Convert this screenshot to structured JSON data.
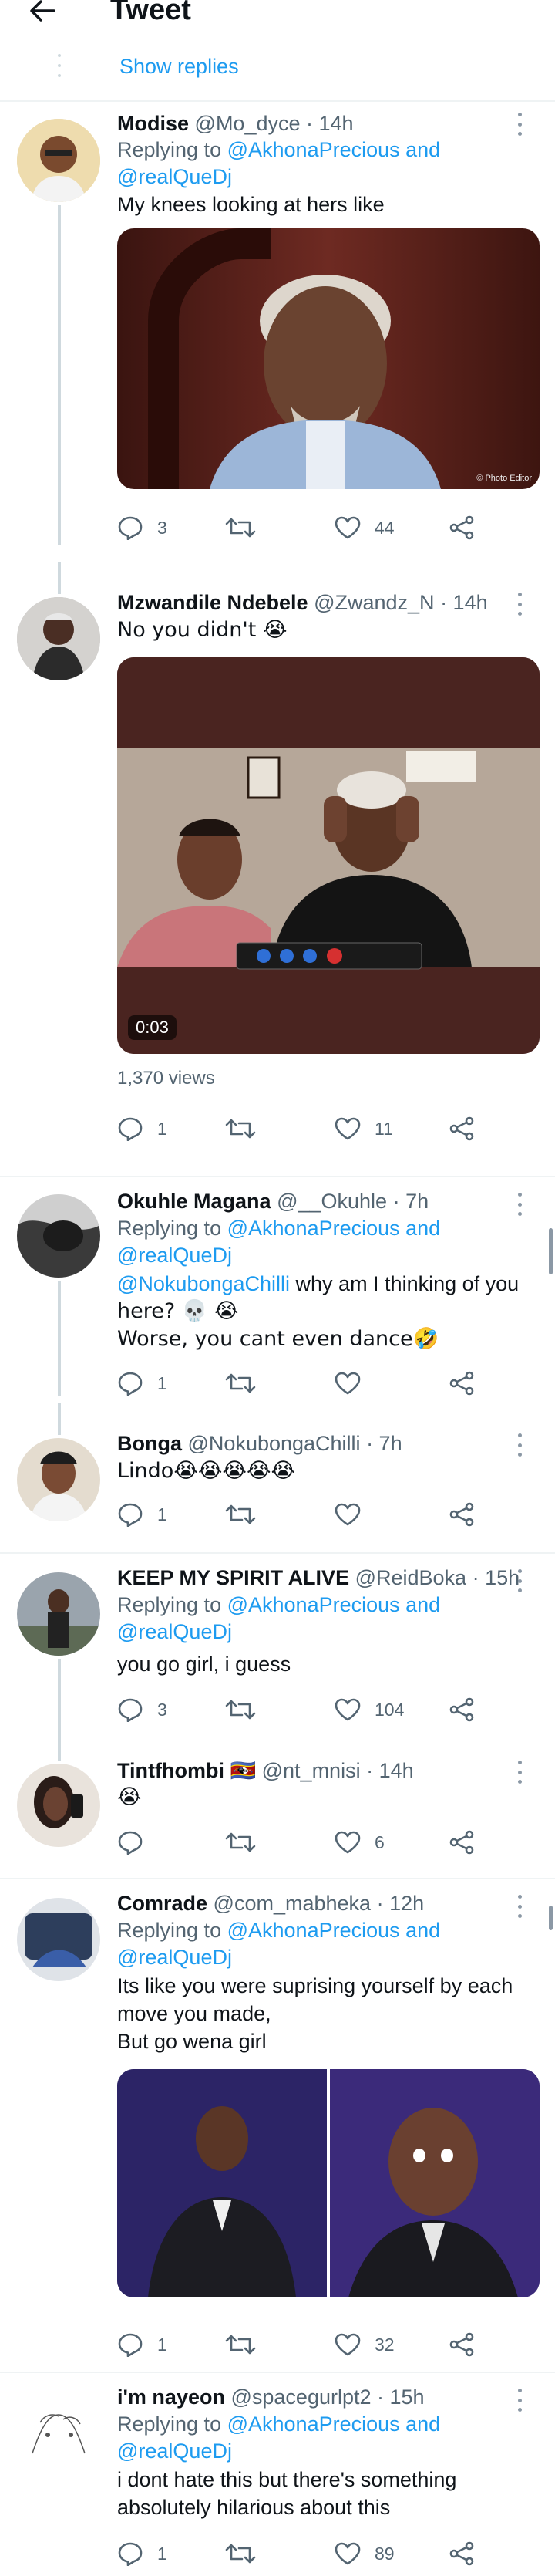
{
  "header": {
    "title": "Tweet"
  },
  "show_replies": "Show replies",
  "replies": [
    {
      "name": "Modise",
      "handle": "@Mo_dyce",
      "time": "· 14h",
      "replying_prefix": "Replying to",
      "replying_to": "@AkhonaPrecious and",
      "replying_to2": "@realQueDj",
      "text": "My knees looking at hers like",
      "image_watermark": "© Photo Editor",
      "counts": {
        "replies": "3",
        "likes": "44"
      }
    },
    {
      "name": "Mzwandile Ndebele",
      "handle": "@Zwandz_N",
      "time": "· 14h",
      "text": "No you didn't 😭",
      "video_duration": "0:03",
      "views": "1,370 views",
      "counts": {
        "replies": "1",
        "likes": "11"
      }
    },
    {
      "name": "Okuhle Magana",
      "handle": "@__Okuhle",
      "time": "· 7h",
      "replying_prefix": "Replying to",
      "replying_to": "@AkhonaPrecious and",
      "replying_to2": "@realQueDj",
      "mention": "@NokubongaChilli",
      "text1": " why am I thinking of you",
      "text2": "here? 💀 😭",
      "text3": "Worse, you cant even dance🤣",
      "counts": {
        "replies": "1",
        "likes": ""
      }
    },
    {
      "name": "Bonga",
      "handle": "@NokubongaChilli",
      "time": "· 7h",
      "text": "Lindo😭😭😭😭😭",
      "counts": {
        "replies": "1",
        "likes": ""
      }
    },
    {
      "name": "KEEP MY SPIRIT ALIVE",
      "handle": "@ReidBoka",
      "time": "· 15h",
      "replying_prefix": "Replying to",
      "replying_to": "@AkhonaPrecious and",
      "replying_to2": "@realQueDj",
      "text": "you go girl, i guess",
      "counts": {
        "replies": "3",
        "likes": "104"
      }
    },
    {
      "name": "Tintfhombi",
      "flag": "🇸🇿",
      "handle": "@nt_mnisi",
      "time": "· 14h",
      "text": "😭",
      "counts": {
        "replies": "",
        "likes": "6"
      }
    },
    {
      "name": "Comrade",
      "handle": "@com_mabheka",
      "time": "· 12h",
      "replying_prefix": "Replying to",
      "replying_to": "@AkhonaPrecious and",
      "replying_to2": "@realQueDj",
      "text1": "Its like you were suprising yourself by each",
      "text2": "move you made,",
      "text3": "But go wena girl",
      "counts": {
        "replies": "1",
        "likes": "32"
      }
    },
    {
      "name": "i'm nayeon",
      "handle": "@spacegurlpt2",
      "time": "· 15h",
      "replying_prefix": "Replying to",
      "replying_to": "@AkhonaPrecious and",
      "replying_to2": "@realQueDj",
      "text1": "i dont hate this but there's something",
      "text2": "absolutely hilarious about this",
      "counts": {
        "replies": "1",
        "likes": "89"
      }
    }
  ],
  "icons": {
    "back": "arrow-left-icon",
    "reply": "reply-icon",
    "retweet": "retweet-icon",
    "like": "heart-icon",
    "share": "share-icon",
    "more": "more-icon"
  },
  "colors": {
    "link": "#1d9bf0",
    "secondary": "#536471",
    "thread": "#cfd9de"
  }
}
